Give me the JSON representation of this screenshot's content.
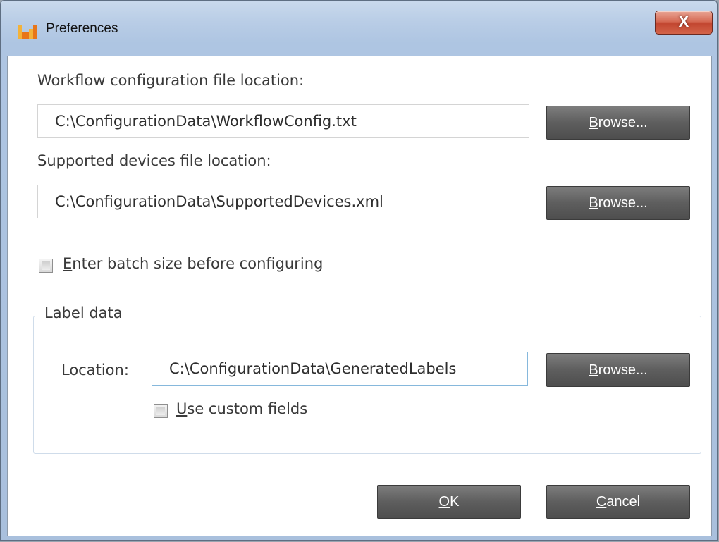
{
  "window": {
    "title": "Preferences",
    "close_label": "X"
  },
  "workflow": {
    "label": "Workflow configuration file location:",
    "path": "C:\\ConfigurationData\\WorkflowConfig.txt",
    "browse_mnemonic": "B",
    "browse_rest": "rowse..."
  },
  "devices": {
    "label": "Supported devices file location:",
    "path": "C:\\ConfigurationData\\SupportedDevices.xml",
    "browse_mnemonic": "B",
    "browse_rest": "rowse..."
  },
  "batch": {
    "mnemonic": "E",
    "rest": "nter batch size before configuring",
    "checked": false
  },
  "label_data": {
    "group_title": "Label data",
    "location_label": "Location:",
    "location_path": "C:\\ConfigurationData\\GeneratedLabels",
    "browse_mnemonic": "B",
    "browse_rest": "rowse...",
    "custom_mnemonic": "U",
    "custom_rest": "se custom fields",
    "custom_checked": false
  },
  "footer": {
    "ok_mnemonic": "O",
    "ok_rest": "K",
    "cancel_mnemonic": "C",
    "cancel_rest": "ancel"
  },
  "colors": {
    "button_bg": "#5e5e5e",
    "focus_border": "#86b8dc",
    "close_red": "#c24630"
  },
  "icons": {
    "app": "app-window-icon",
    "close": "close-icon"
  }
}
